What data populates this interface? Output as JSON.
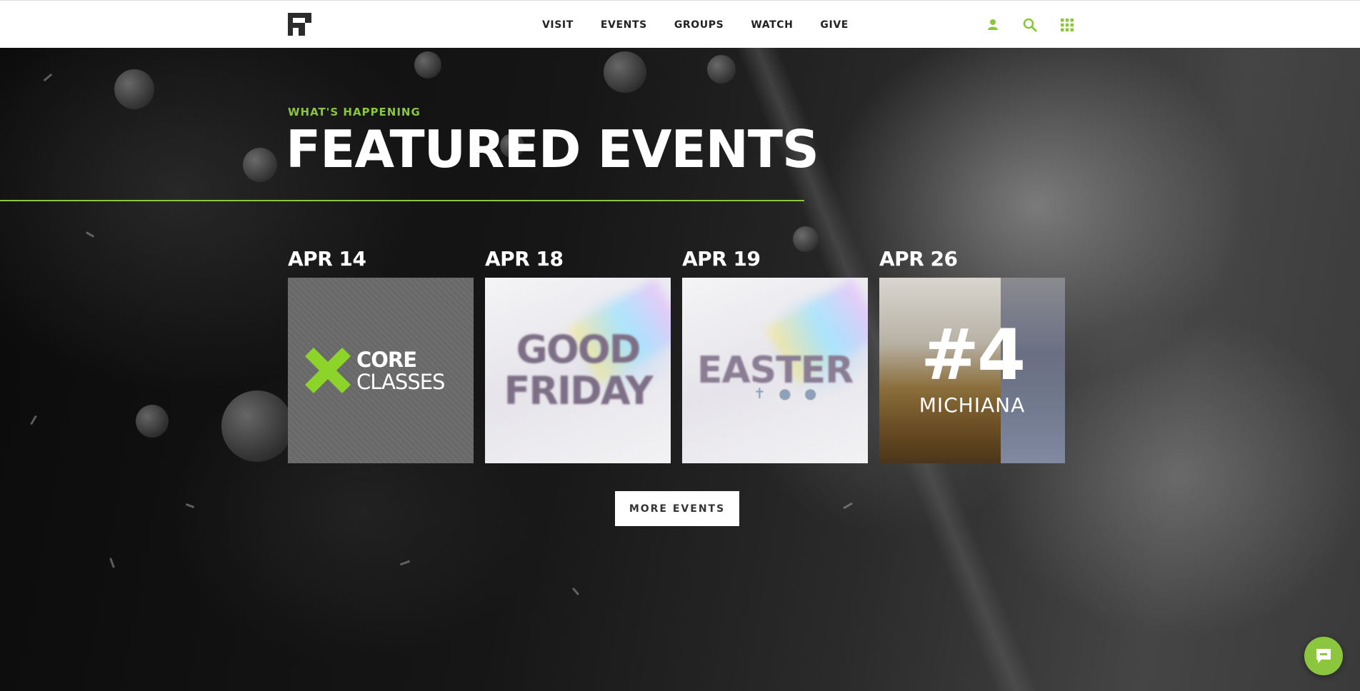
{
  "nav": {
    "menu": [
      "VISIT",
      "EVENTS",
      "GROUPS",
      "WATCH",
      "GIVE"
    ],
    "icons": [
      "user-icon",
      "search-icon",
      "grid-menu-icon"
    ],
    "accent": "#8cc63f"
  },
  "hero": {
    "eyebrow": "WHAT'S HAPPENING",
    "title": "FEATURED EVENTS",
    "button": "MORE EVENTS"
  },
  "events": [
    {
      "date": "APR 14",
      "art_line1": "CORE",
      "art_line2": "CLASSES"
    },
    {
      "date": "APR 18",
      "art_line1": "GOOD",
      "art_line2": "FRIDAY"
    },
    {
      "date": "APR 19",
      "art_line1": "EASTER"
    },
    {
      "date": "APR 26",
      "art_line1": "#4",
      "art_line2": "MICHIANA"
    }
  ],
  "chat": {
    "icon": "chat-icon"
  }
}
